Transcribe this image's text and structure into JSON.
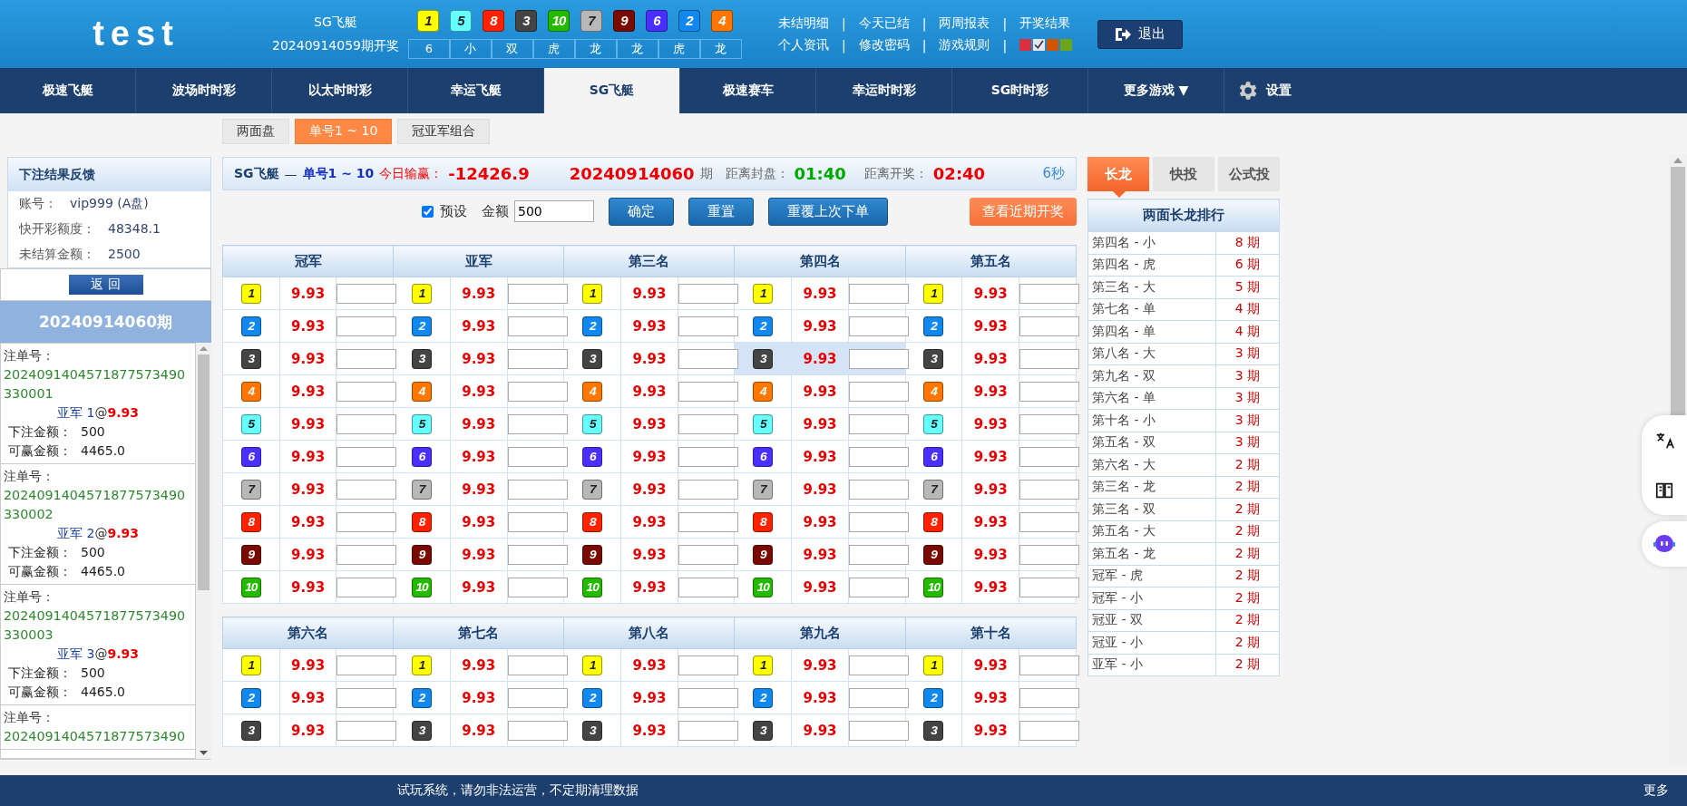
{
  "header": {
    "logo": "test",
    "game": "SG飞艇",
    "last_period": "20240914059期开奖",
    "result_balls": [
      {
        "number": "1",
        "color": "#ffff00"
      },
      {
        "number": "5",
        "color": "#66ffff"
      },
      {
        "number": "8",
        "color": "#ff2200"
      },
      {
        "number": "3",
        "color": "#444444"
      },
      {
        "number": "10",
        "color": "#22bb00"
      },
      {
        "number": "7",
        "color": "#b8b8b8"
      },
      {
        "number": "9",
        "color": "#7a0a00"
      },
      {
        "number": "6",
        "color": "#4a30ff"
      },
      {
        "number": "2",
        "color": "#1188ee"
      },
      {
        "number": "4",
        "color": "#ff7700"
      }
    ],
    "result_stats": [
      "6",
      "小",
      "双",
      "虎",
      "龙",
      "龙",
      "虎",
      "龙"
    ],
    "links_top": [
      "未结明细",
      "今天已结",
      "两周报表",
      "开奖结果"
    ],
    "links_bottom": [
      "个人资讯",
      "修改密码",
      "游戏规则"
    ],
    "separator": "|",
    "themes": [
      {
        "color": "#d9303d",
        "selected": false
      },
      {
        "color": "#e6e6f2",
        "selected": true
      },
      {
        "color": "#d35400",
        "selected": false
      },
      {
        "color": "#6aa51c",
        "selected": false
      }
    ],
    "logout": "退出"
  },
  "nav": {
    "items": [
      {
        "label": "极速飞艇",
        "selected": false
      },
      {
        "label": "波场时时彩",
        "selected": false
      },
      {
        "label": "以太时时彩",
        "selected": false
      },
      {
        "label": "幸运飞艇",
        "selected": false
      },
      {
        "label": "SG飞艇",
        "selected": true
      },
      {
        "label": "极速赛车",
        "selected": false
      },
      {
        "label": "幸运时时彩",
        "selected": false
      },
      {
        "label": "SG时时彩",
        "selected": false
      },
      {
        "label": "更多游戏 ▼",
        "selected": false
      }
    ],
    "settings": "设置"
  },
  "subtabs": [
    {
      "label": "两面盘",
      "selected": false
    },
    {
      "label": "单号1 ~ 10",
      "selected": true
    },
    {
      "label": "冠亚军组合",
      "selected": false
    }
  ],
  "sidebar": {
    "title": "下注结果反馈",
    "account": [
      {
        "label": "账号：",
        "value": "vip999 (A盘)"
      },
      {
        "label": "快开彩额度：",
        "value": "48348.1"
      },
      {
        "label": "未结算金额：",
        "value": "2500"
      }
    ],
    "back": "返 回",
    "period": "20240914060期",
    "bets": [
      {
        "order_label": "注单号：",
        "order_no": "2024091404571877573490330001",
        "selection": "亚军 1",
        "at": "@",
        "odds": "9.93",
        "amount_label": "下注金额：",
        "amount": "500",
        "win_label": "可赢金额：",
        "win": "4465.0"
      },
      {
        "order_label": "注单号：",
        "order_no": "2024091404571877573490330002",
        "selection": "亚军 2",
        "at": "@",
        "odds": "9.93",
        "amount_label": "下注金额：",
        "amount": "500",
        "win_label": "可赢金额：",
        "win": "4465.0"
      },
      {
        "order_label": "注单号：",
        "order_no": "2024091404571877573490330003",
        "selection": "亚军 3",
        "at": "@",
        "odds": "9.93",
        "amount_label": "下注金额：",
        "amount": "500",
        "win_label": "可赢金额：",
        "win": "4465.0"
      },
      {
        "order_label": "注单号：",
        "order_no": "2024091404571877573490"
      }
    ]
  },
  "info": {
    "game": "SG飞艇",
    "dash": "—",
    "mode": "单号1 ~ 10",
    "profit_label": "今日输赢：",
    "profit": "-12426.9",
    "period": "20240914060",
    "period_suffix": "期",
    "close_label": "距离封盘：",
    "close_time": "01:40",
    "draw_label": "距离开奖：",
    "draw_time": "02:40",
    "refresh": "6秒"
  },
  "controls": {
    "preset_label": "预设",
    "preset_checked": true,
    "amount_label": "金额",
    "amount": "500",
    "buttons": [
      "确定",
      "重置",
      "重覆上次下单"
    ],
    "recent": "查看近期开奖"
  },
  "tables": [
    {
      "groups": [
        {
          "title": "冠军",
          "cells": [
            {
              "number": "1",
              "color": "#ffff00",
              "odds": "9.93",
              "highlighted": false
            },
            {
              "number": "2",
              "color": "#1188ee",
              "odds": "9.93",
              "highlighted": false
            },
            {
              "number": "3",
              "color": "#444444",
              "odds": "9.93",
              "highlighted": false
            },
            {
              "number": "4",
              "color": "#ff7700",
              "odds": "9.93",
              "highlighted": false
            },
            {
              "number": "5",
              "color": "#66ffff",
              "odds": "9.93",
              "highlighted": false
            },
            {
              "number": "6",
              "color": "#4a30ff",
              "odds": "9.93",
              "highlighted": false
            },
            {
              "number": "7",
              "color": "#b8b8b8",
              "odds": "9.93",
              "highlighted": false
            },
            {
              "number": "8",
              "color": "#ff2200",
              "odds": "9.93",
              "highlighted": false
            },
            {
              "number": "9",
              "color": "#7a0a00",
              "odds": "9.93",
              "highlighted": false
            },
            {
              "number": "10",
              "color": "#22bb00",
              "odds": "9.93",
              "highlighted": false
            }
          ]
        },
        {
          "title": "亚军",
          "cells": [
            {
              "number": "1",
              "color": "#ffff00",
              "odds": "9.93",
              "highlighted": false
            },
            {
              "number": "2",
              "color": "#1188ee",
              "odds": "9.93",
              "highlighted": false
            },
            {
              "number": "3",
              "color": "#444444",
              "odds": "9.93",
              "highlighted": false
            },
            {
              "number": "4",
              "color": "#ff7700",
              "odds": "9.93",
              "highlighted": false
            },
            {
              "number": "5",
              "color": "#66ffff",
              "odds": "9.93",
              "highlighted": false
            },
            {
              "number": "6",
              "color": "#4a30ff",
              "odds": "9.93",
              "highlighted": false
            },
            {
              "number": "7",
              "color": "#b8b8b8",
              "odds": "9.93",
              "highlighted": false
            },
            {
              "number": "8",
              "color": "#ff2200",
              "odds": "9.93",
              "highlighted": false
            },
            {
              "number": "9",
              "color": "#7a0a00",
              "odds": "9.93",
              "highlighted": false
            },
            {
              "number": "10",
              "color": "#22bb00",
              "odds": "9.93",
              "highlighted": false
            }
          ]
        },
        {
          "title": "第三名",
          "cells": [
            {
              "number": "1",
              "color": "#ffff00",
              "odds": "9.93",
              "highlighted": false
            },
            {
              "number": "2",
              "color": "#1188ee",
              "odds": "9.93",
              "highlighted": false
            },
            {
              "number": "3",
              "color": "#444444",
              "odds": "9.93",
              "highlighted": false
            },
            {
              "number": "4",
              "color": "#ff7700",
              "odds": "9.93",
              "highlighted": false
            },
            {
              "number": "5",
              "color": "#66ffff",
              "odds": "9.93",
              "highlighted": false
            },
            {
              "number": "6",
              "color": "#4a30ff",
              "odds": "9.93",
              "highlighted": false
            },
            {
              "number": "7",
              "color": "#b8b8b8",
              "odds": "9.93",
              "highlighted": false
            },
            {
              "number": "8",
              "color": "#ff2200",
              "odds": "9.93",
              "highlighted": false
            },
            {
              "number": "9",
              "color": "#7a0a00",
              "odds": "9.93",
              "highlighted": false
            },
            {
              "number": "10",
              "color": "#22bb00",
              "odds": "9.93",
              "highlighted": false
            }
          ]
        },
        {
          "title": "第四名",
          "cells": [
            {
              "number": "1",
              "color": "#ffff00",
              "odds": "9.93",
              "highlighted": false
            },
            {
              "number": "2",
              "color": "#1188ee",
              "odds": "9.93",
              "highlighted": false
            },
            {
              "number": "3",
              "color": "#444444",
              "odds": "9.93",
              "highlighted": true
            },
            {
              "number": "4",
              "color": "#ff7700",
              "odds": "9.93",
              "highlighted": false
            },
            {
              "number": "5",
              "color": "#66ffff",
              "odds": "9.93",
              "highlighted": false
            },
            {
              "number": "6",
              "color": "#4a30ff",
              "odds": "9.93",
              "highlighted": false
            },
            {
              "number": "7",
              "color": "#b8b8b8",
              "odds": "9.93",
              "highlighted": false
            },
            {
              "number": "8",
              "color": "#ff2200",
              "odds": "9.93",
              "highlighted": false
            },
            {
              "number": "9",
              "color": "#7a0a00",
              "odds": "9.93",
              "highlighted": false
            },
            {
              "number": "10",
              "color": "#22bb00",
              "odds": "9.93",
              "highlighted": false
            }
          ]
        },
        {
          "title": "第五名",
          "cells": [
            {
              "number": "1",
              "color": "#ffff00",
              "odds": "9.93",
              "highlighted": false
            },
            {
              "number": "2",
              "color": "#1188ee",
              "odds": "9.93",
              "highlighted": false
            },
            {
              "number": "3",
              "color": "#444444",
              "odds": "9.93",
              "highlighted": false
            },
            {
              "number": "4",
              "color": "#ff7700",
              "odds": "9.93",
              "highlighted": false
            },
            {
              "number": "5",
              "color": "#66ffff",
              "odds": "9.93",
              "highlighted": false
            },
            {
              "number": "6",
              "color": "#4a30ff",
              "odds": "9.93",
              "highlighted": false
            },
            {
              "number": "7",
              "color": "#b8b8b8",
              "odds": "9.93",
              "highlighted": false
            },
            {
              "number": "8",
              "color": "#ff2200",
              "odds": "9.93",
              "highlighted": false
            },
            {
              "number": "9",
              "color": "#7a0a00",
              "odds": "9.93",
              "highlighted": false
            },
            {
              "number": "10",
              "color": "#22bb00",
              "odds": "9.93",
              "highlighted": false
            }
          ]
        }
      ]
    },
    {
      "groups": [
        {
          "title": "第六名",
          "cells": [
            {
              "number": "1",
              "color": "#ffff00",
              "odds": "9.93",
              "highlighted": false
            },
            {
              "number": "2",
              "color": "#1188ee",
              "odds": "9.93",
              "highlighted": false
            },
            {
              "number": "3",
              "color": "#444444",
              "odds": "9.93",
              "highlighted": false
            }
          ]
        },
        {
          "title": "第七名",
          "cells": [
            {
              "number": "1",
              "color": "#ffff00",
              "odds": "9.93",
              "highlighted": false
            },
            {
              "number": "2",
              "color": "#1188ee",
              "odds": "9.93",
              "highlighted": false
            },
            {
              "number": "3",
              "color": "#444444",
              "odds": "9.93",
              "highlighted": false
            }
          ]
        },
        {
          "title": "第八名",
          "cells": [
            {
              "number": "1",
              "color": "#ffff00",
              "odds": "9.93",
              "highlighted": false
            },
            {
              "number": "2",
              "color": "#1188ee",
              "odds": "9.93",
              "highlighted": false
            },
            {
              "number": "3",
              "color": "#444444",
              "odds": "9.93",
              "highlighted": false
            }
          ]
        },
        {
          "title": "第九名",
          "cells": [
            {
              "number": "1",
              "color": "#ffff00",
              "odds": "9.93",
              "highlighted": false
            },
            {
              "number": "2",
              "color": "#1188ee",
              "odds": "9.93",
              "highlighted": false
            },
            {
              "number": "3",
              "color": "#444444",
              "odds": "9.93",
              "highlighted": false
            }
          ]
        },
        {
          "title": "第十名",
          "cells": [
            {
              "number": "1",
              "color": "#ffff00",
              "odds": "9.93",
              "highlighted": false
            },
            {
              "number": "2",
              "color": "#1188ee",
              "odds": "9.93",
              "highlighted": false
            },
            {
              "number": "3",
              "color": "#444444",
              "odds": "9.93",
              "highlighted": false
            }
          ]
        }
      ]
    }
  ],
  "right": {
    "tabs": [
      {
        "label": "长龙",
        "selected": true
      },
      {
        "label": "快投",
        "selected": false
      },
      {
        "label": "公式投",
        "selected": false
      }
    ],
    "title": "两面长龙排行",
    "rows": [
      {
        "name": "第四名 - 小",
        "count": "8 期"
      },
      {
        "name": "第四名 - 虎",
        "count": "6 期"
      },
      {
        "name": "第三名 - 大",
        "count": "5 期"
      },
      {
        "name": "第七名 - 单",
        "count": "4 期"
      },
      {
        "name": "第四名 - 单",
        "count": "4 期"
      },
      {
        "name": "第八名 - 大",
        "count": "3 期"
      },
      {
        "name": "第九名 - 双",
        "count": "3 期"
      },
      {
        "name": "第六名 - 单",
        "count": "3 期"
      },
      {
        "name": "第十名 - 小",
        "count": "3 期"
      },
      {
        "name": "第五名 - 双",
        "count": "3 期"
      },
      {
        "name": "第六名 - 大",
        "count": "2 期"
      },
      {
        "name": "第三名 - 龙",
        "count": "2 期"
      },
      {
        "name": "第三名 - 双",
        "count": "2 期"
      },
      {
        "name": "第五名 - 大",
        "count": "2 期"
      },
      {
        "name": "第五名 - 龙",
        "count": "2 期"
      },
      {
        "name": "冠军 - 虎",
        "count": "2 期"
      },
      {
        "name": "冠军 - 小",
        "count": "2 期"
      },
      {
        "name": "冠亚 - 双",
        "count": "2 期"
      },
      {
        "name": "冠亚 - 小",
        "count": "2 期"
      },
      {
        "name": "亚军 - 小",
        "count": "2 期"
      }
    ]
  },
  "footer": {
    "notice": "试玩系统，请勿非法运营，不定期清理数据",
    "more": "更多"
  }
}
